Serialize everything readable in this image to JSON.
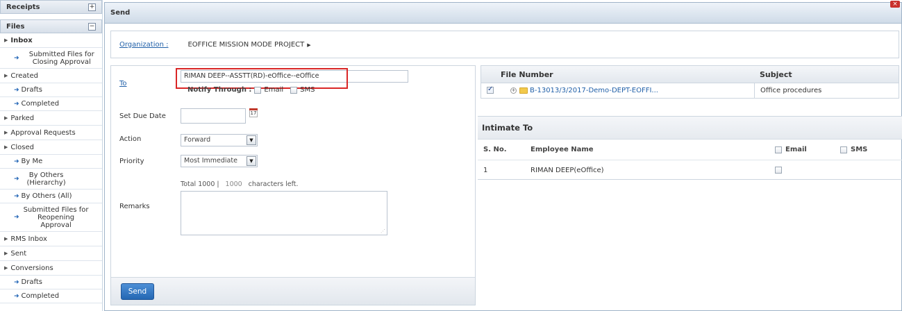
{
  "sidebar": {
    "receipts_label": "Receipts",
    "receipts_toggle": "+",
    "files_label": "Files",
    "files_toggle": "−",
    "items": [
      {
        "label": "Inbox",
        "kind": "top",
        "bold": true
      },
      {
        "label": "Submitted Files for Closing Approval",
        "kind": "sub"
      },
      {
        "label": "Created",
        "kind": "top"
      },
      {
        "label": "Drafts",
        "kind": "sub"
      },
      {
        "label": "Completed",
        "kind": "sub"
      },
      {
        "label": "Parked",
        "kind": "top"
      },
      {
        "label": "Approval Requests",
        "kind": "top"
      },
      {
        "label": "Closed",
        "kind": "top"
      },
      {
        "label": "By Me",
        "kind": "sub"
      },
      {
        "label": "By Others (Hierarchy)",
        "kind": "sub"
      },
      {
        "label": "By Others (All)",
        "kind": "sub"
      },
      {
        "label": "Submitted Files for Reopening Approval",
        "kind": "sub"
      },
      {
        "label": "RMS Inbox",
        "kind": "top"
      },
      {
        "label": "Sent",
        "kind": "top"
      },
      {
        "label": "Conversions",
        "kind": "top"
      },
      {
        "label": "Drafts",
        "kind": "sub"
      },
      {
        "label": "Completed",
        "kind": "sub"
      }
    ]
  },
  "window": {
    "title": "Send",
    "close_glyph": "×"
  },
  "organization": {
    "label": "Organization :",
    "value": "EOFFICE MISSION MODE PROJECT"
  },
  "form": {
    "to_label": "To",
    "to_value": "RIMAN DEEP--ASSTT(RD)-eOffice--eOffice",
    "notify_label": "Notify Through :",
    "notify_email": "Email",
    "notify_sms": "SMS",
    "due_date_label": "Set Due Date",
    "due_date_value": "",
    "calendar_day": "17",
    "action_label": "Action",
    "action_value": "Forward",
    "priority_label": "Priority",
    "priority_value": "Most Immediate",
    "chars_total": "Total 1000 |",
    "chars_count": "1000",
    "chars_suffix": "characters left.",
    "remarks_label": "Remarks",
    "remarks_value": "",
    "send_label": "Send"
  },
  "file_table": {
    "headers": {
      "file_number": "File Number",
      "subject": "Subject"
    },
    "rows": [
      {
        "checked": true,
        "file_number": "B-13013/3/2017-Demo-DEPT-EOFFI...",
        "subject": "Office procedures"
      }
    ]
  },
  "intimate": {
    "title": "Intimate To",
    "headers": {
      "sno": "S. No.",
      "name": "Employee Name",
      "email": "Email",
      "sms": "SMS"
    },
    "rows": [
      {
        "sno": "1",
        "name": "RIMAN DEEP(eOffice)"
      }
    ]
  }
}
